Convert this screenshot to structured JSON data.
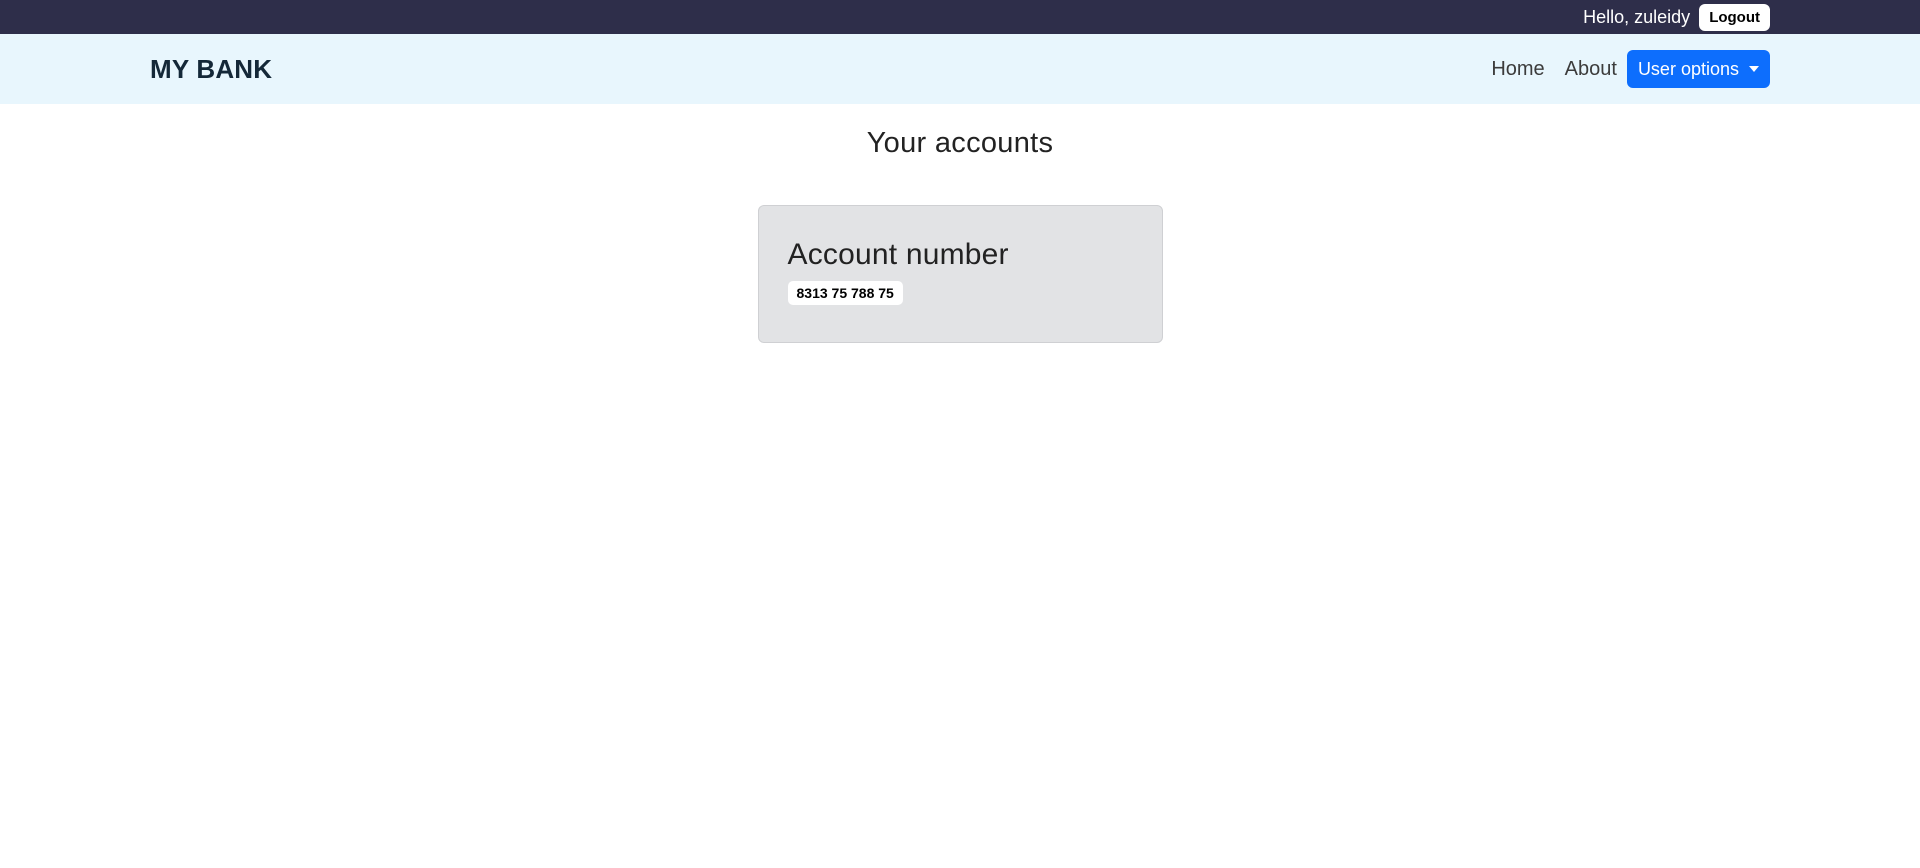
{
  "topbar": {
    "greeting": "Hello, zuleidy",
    "logout_label": "Logout"
  },
  "navbar": {
    "brand": "MY BANK",
    "links": [
      {
        "label": "Home"
      },
      {
        "label": "About"
      }
    ],
    "user_options_label": "User options"
  },
  "main": {
    "title": "Your accounts",
    "accounts": [
      {
        "heading": "Account number",
        "number": "8313 75 788 75"
      }
    ]
  },
  "colors": {
    "topbar_bg": "#2e2e4a",
    "navbar_bg": "#e8f6fd",
    "primary": "#0d6efd",
    "card_bg": "#e2e3e5"
  }
}
